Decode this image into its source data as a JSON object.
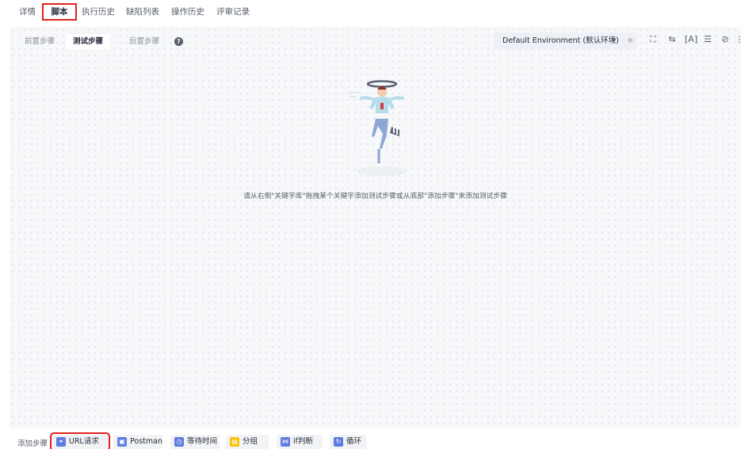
{
  "top_tabs": [
    {
      "label": "详情"
    },
    {
      "label": "脚本"
    },
    {
      "label": "执行历史"
    },
    {
      "label": "缺陷列表"
    },
    {
      "label": "操作历史"
    },
    {
      "label": "评审记录"
    }
  ],
  "step_tabs": [
    {
      "label": "前置步骤"
    },
    {
      "label": "测试步骤"
    },
    {
      "label": "后置步骤"
    }
  ],
  "environment": {
    "selected": "Default Environment (默认环境)"
  },
  "toolbar_icons": [
    "fullscreen-icon",
    "swap-icon",
    "variable-icon",
    "list-icon",
    "debug-icon",
    "more-icon"
  ],
  "empty_state": {
    "text": "请从右侧\"关键字库\"拖拽某个关键字添加测试步骤或从底部\"添加步骤\"来添加测试步骤"
  },
  "bottom": {
    "add_label": "添加步骤",
    "buttons": [
      {
        "label": "URL请求",
        "icon": "link-icon",
        "color": "#5e7ce0"
      },
      {
        "label": "Postman",
        "icon": "postman-icon",
        "color": "#5e7ce0"
      },
      {
        "label": "等待时间",
        "icon": "clock-icon",
        "color": "#5e7ce0"
      },
      {
        "label": "分组",
        "icon": "group-icon",
        "color": "#fac20a"
      },
      {
        "label": "if判断",
        "icon": "branch-icon",
        "color": "#5e7ce0"
      },
      {
        "label": "循环",
        "icon": "loop-icon",
        "color": "#5e7ce0"
      }
    ]
  },
  "colors": {
    "accent": "#5e7ce0",
    "highlight_border": "#e02020",
    "canvas_bg": "#f7f8fa"
  }
}
